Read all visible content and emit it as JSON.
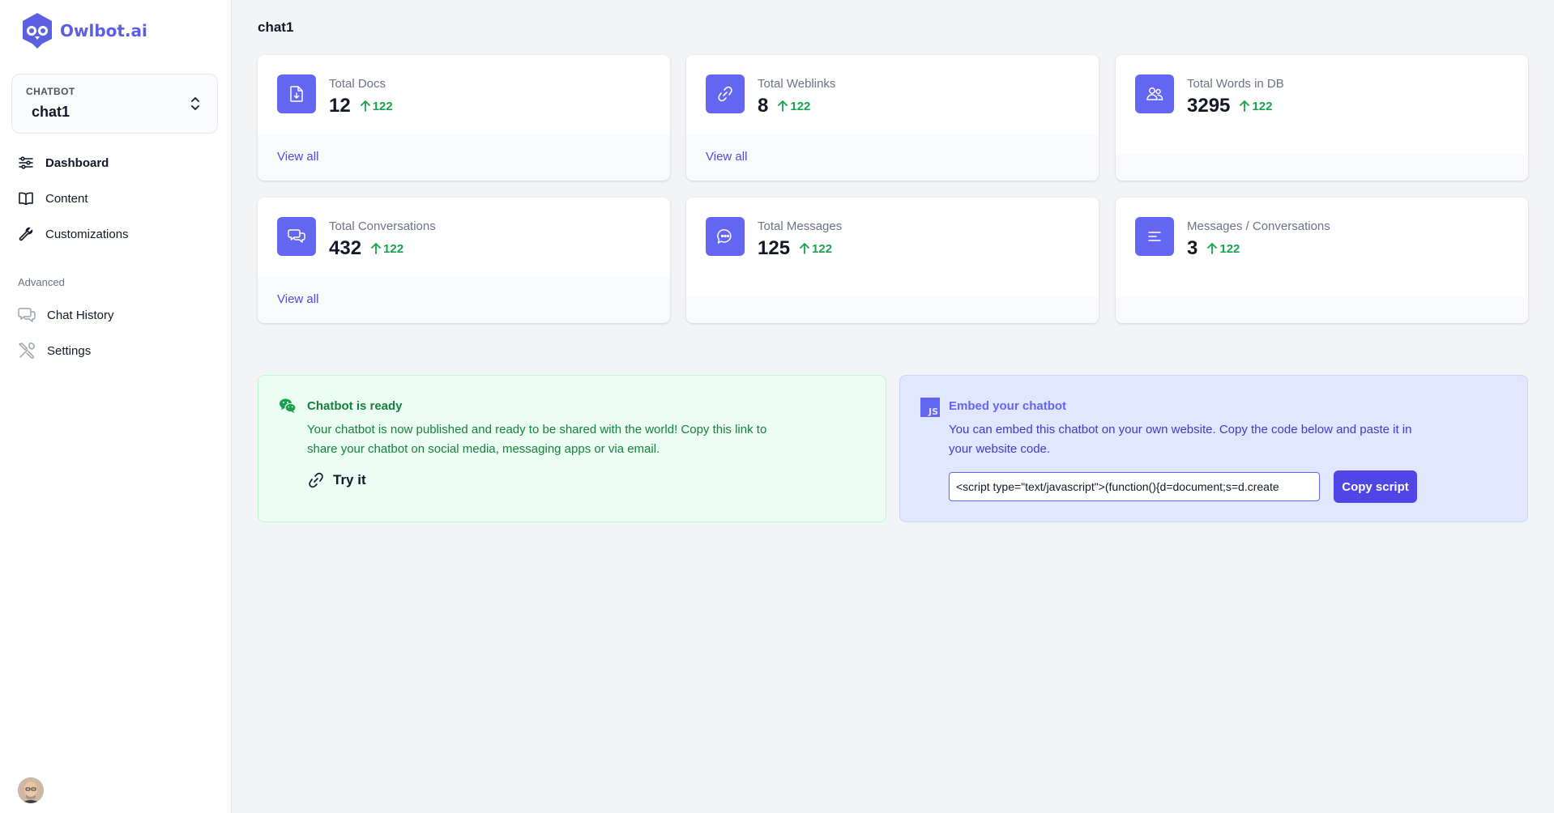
{
  "app": {
    "name": "Owlbot.ai"
  },
  "chatbot_selector": {
    "label": "CHATBOT",
    "value": "chat1"
  },
  "nav": {
    "main": [
      {
        "label": "Dashboard",
        "icon": "sliders-icon",
        "active": true
      },
      {
        "label": "Content",
        "icon": "book-icon",
        "active": false
      },
      {
        "label": "Customizations",
        "icon": "wrench-icon",
        "active": false
      }
    ],
    "advanced_label": "Advanced",
    "advanced": [
      {
        "label": "Chat History",
        "icon": "chat-bubbles-icon"
      },
      {
        "label": "Settings",
        "icon": "tools-icon"
      }
    ]
  },
  "page": {
    "title": "chat1"
  },
  "stats": [
    {
      "label": "Total Docs",
      "value": "12",
      "delta": "122",
      "link": "View all",
      "icon": "document-download-icon"
    },
    {
      "label": "Total Weblinks",
      "value": "8",
      "delta": "122",
      "link": "View all",
      "icon": "link-icon"
    },
    {
      "label": "Total Words in DB",
      "value": "3295",
      "delta": "122",
      "link": "",
      "icon": "users-icon"
    },
    {
      "label": "Total Conversations",
      "value": "432",
      "delta": "122",
      "link": "View all",
      "icon": "chat-bubbles-icon"
    },
    {
      "label": "Total Messages",
      "value": "125",
      "delta": "122",
      "link": "",
      "icon": "chat-dots-icon"
    },
    {
      "label": "Messages / Conversations",
      "value": "3",
      "delta": "122",
      "link": "",
      "icon": "text-lines-icon"
    }
  ],
  "ready_panel": {
    "title": "Chatbot is ready",
    "text": "Your chatbot is now published and ready to be shared with the world! Copy this link to share your chatbot on social media, messaging apps or via email.",
    "action": "Try it"
  },
  "embed_panel": {
    "badge": "JS",
    "title": "Embed your chatbot",
    "text": "You can embed this chatbot on your own website. Copy the code below and paste it in your website code.",
    "code": "<script type=\"text/javascript\">(function(){d=document;s=d.create",
    "button": "Copy script"
  },
  "colors": {
    "accent": "#6366f1",
    "primary_button": "#4f46e5",
    "positive": "#16a34a"
  }
}
